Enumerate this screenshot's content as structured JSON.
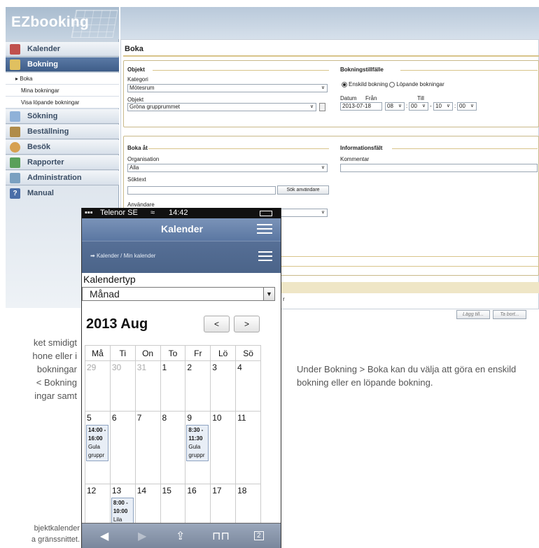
{
  "app": {
    "logo": "EZbooking"
  },
  "sidebar": {
    "items": [
      {
        "label": "Kalender",
        "icon": "calendar-icon",
        "active": false
      },
      {
        "label": "Bokning",
        "icon": "booking-icon",
        "active": true
      },
      {
        "label": "Sökning",
        "icon": "search-icon",
        "active": false
      },
      {
        "label": "Beställning",
        "icon": "cart-icon",
        "active": false
      },
      {
        "label": "Besök",
        "icon": "visitor-icon",
        "active": false
      },
      {
        "label": "Rapporter",
        "icon": "chart-icon",
        "active": false
      },
      {
        "label": "Administration",
        "icon": "admin-icon",
        "active": false
      },
      {
        "label": "Manual",
        "icon": "help-icon",
        "active": false
      }
    ],
    "subitems": [
      "Boka",
      "Mina bokningar",
      "Visa löpande bokningar"
    ]
  },
  "main": {
    "title": "Boka",
    "objekt": {
      "heading": "Objekt",
      "kategori_label": "Kategori",
      "kategori_value": "Mötesrum",
      "objekt_label": "Objekt",
      "objekt_value": "Gröna grupprummet"
    },
    "bokningstillfalle": {
      "heading": "Bokningstillfälle",
      "radio1": "Enskild bokning",
      "radio2": "Löpande bokningar",
      "datum_label": "Datum",
      "fran_label": "Från",
      "till_label": "Till",
      "datum_value": "2013-07-18",
      "fran_h": "08",
      "fran_m": "00",
      "till_h": "10",
      "till_m": "00"
    },
    "boka_at": {
      "heading": "Boka åt",
      "org_label": "Organisation",
      "org_value": "Alla",
      "soktext_label": "Söktext",
      "sok_button": "Sök användare",
      "anvandare_label": "Användare"
    },
    "info": {
      "heading": "Informationsfält",
      "kommentar_label": "Kommentar"
    },
    "stray_letter": "r",
    "add_button": "Lägg till...",
    "remove_button": "Ta bort..."
  },
  "text": {
    "left_para": [
      "ket smidigt",
      "hone eller i",
      "bokningar",
      "Bokning >",
      "ingar samt"
    ],
    "right_para": "Under Bokning > Boka kan du välja att göra en enskild bokning eller en löpande bokning.",
    "footnote": [
      "bjektkalender",
      "a gränssnittet."
    ]
  },
  "phone": {
    "status": {
      "carrier": "Telenor SE",
      "time": "14:42"
    },
    "title": "Kalender",
    "breadcrumb": "Kalender / Min kalender",
    "kalendertyp_label": "Kalendertyp",
    "kalendertyp_value": "Månad",
    "month": "2013 Aug",
    "prev": "<",
    "next": ">",
    "weekdays": [
      "Må",
      "Ti",
      "On",
      "To",
      "Fr",
      "Lö",
      "Sö"
    ],
    "week1": [
      "29",
      "30",
      "31",
      "1",
      "2",
      "3",
      "4"
    ],
    "week2": [
      "5",
      "6",
      "7",
      "8",
      "9",
      "10",
      "11"
    ],
    "week3": [
      "12",
      "13",
      "14",
      "15",
      "16",
      "17",
      "18"
    ],
    "events": {
      "mon5": {
        "time": "14:00 - 16:00",
        "text": "Gula gruppr"
      },
      "fri9": {
        "time": "8:30 - 11:30",
        "text": "Gula gruppr"
      },
      "tue13": {
        "time": "8:00 - 10:00",
        "text": "Lila gruppr"
      }
    },
    "tabs_badge": "2"
  }
}
